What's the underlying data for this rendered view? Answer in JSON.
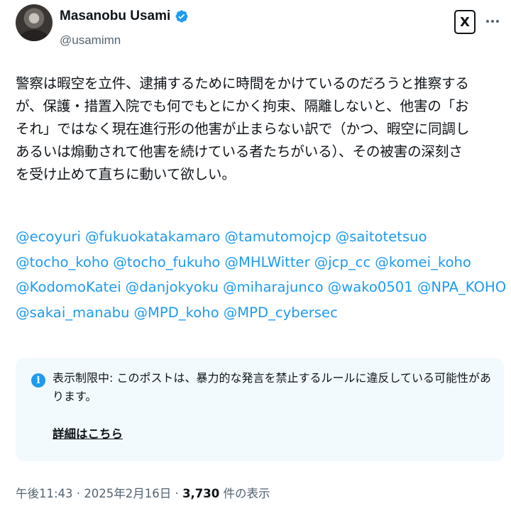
{
  "author": {
    "display_name": "Masanobu Usami",
    "handle": "@usamimn",
    "verified": true,
    "avatar_icon": "user-photo-avatar"
  },
  "actions": {
    "grok_icon_label": "X",
    "more_icon": "more-horizontal-icon"
  },
  "post": {
    "body_lines": [
      "警察は暇空を立件、逮捕するために時間をかけているのだろうと推察する",
      "が、保護・措置入院でも何でもとにかく拘束、隔離しないと、他害の「お",
      "それ」ではなく現在進行形の他害が止まらない訳で（かつ、暇空に同調し",
      "あるいは煽動されて他害を続けている者たちがいる）、その被害の深刻さ",
      "を受け止めて直ちに動いて欲しい。"
    ],
    "mention_lines": [
      [
        "@ecoyuri",
        "@fukuokatakamaro",
        "@tamutomojcp",
        "@saitotetsuo"
      ],
      [
        "@tocho_koho",
        "@tocho_fukuho",
        "@MHLWitter",
        "@jcp_cc",
        "@komei_koho"
      ],
      [
        "@KodomoKatei",
        "@danjokyoku",
        "@miharajunco",
        "@wako0501",
        "@NPA_KOHO"
      ],
      [
        "@sakai_manabu",
        "@MPD_koho",
        "@MPD_cybersec"
      ]
    ]
  },
  "notice": {
    "icon": "info-icon",
    "text": "表示制限中: このポストは、暴力的な発言を禁止するルールに違反している可能性があります。",
    "link_label": "詳細はこちら"
  },
  "meta": {
    "time": "午後11:43",
    "separator": " · ",
    "date": "2025年2月16日",
    "views_count": "3,730",
    "views_label": " 件の表示"
  },
  "colors": {
    "accent": "#1d9bf0",
    "text": "#0f1419",
    "muted": "#536471",
    "notice_bg": "#f3fafe"
  }
}
